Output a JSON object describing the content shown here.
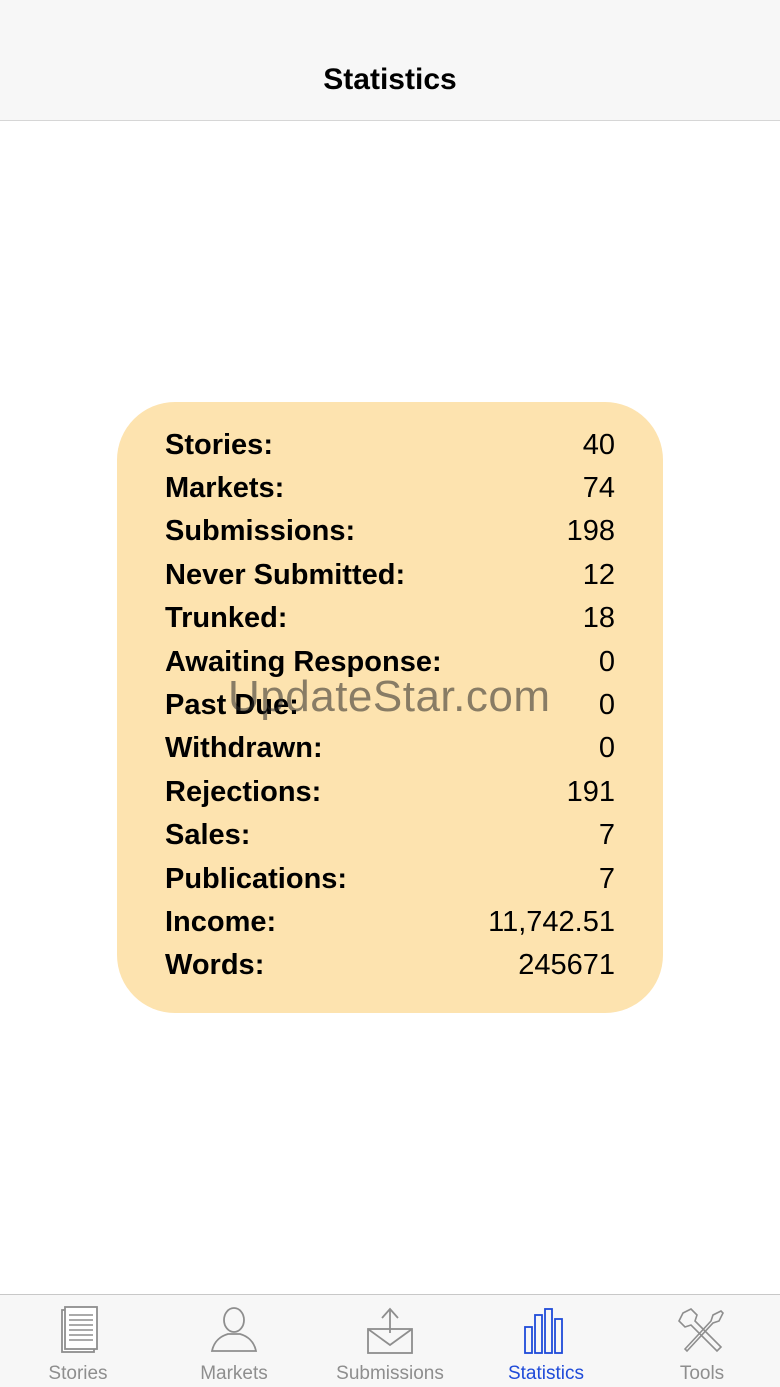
{
  "nav": {
    "title": "Statistics"
  },
  "stats": [
    {
      "label": "Stories:",
      "value": "40"
    },
    {
      "label": "Markets:",
      "value": "74"
    },
    {
      "label": "Submissions:",
      "value": "198"
    },
    {
      "label": "Never Submitted:",
      "value": "12"
    },
    {
      "label": "Trunked:",
      "value": "18"
    },
    {
      "label": "Awaiting Response:",
      "value": "0"
    },
    {
      "label": "Past Due:",
      "value": "0"
    },
    {
      "label": "Withdrawn:",
      "value": "0"
    },
    {
      "label": "Rejections:",
      "value": "191"
    },
    {
      "label": "Sales:",
      "value": "7"
    },
    {
      "label": "Publications:",
      "value": "7"
    },
    {
      "label": "Income:",
      "value": "11,742.51"
    },
    {
      "label": "Words:",
      "value": "245671"
    }
  ],
  "watermark": "UpdateStar.com",
  "tabs": [
    {
      "label": "Stories",
      "icon": "document-icon",
      "active": false
    },
    {
      "label": "Markets",
      "icon": "person-icon",
      "active": false
    },
    {
      "label": "Submissions",
      "icon": "envelope-upload-icon",
      "active": false
    },
    {
      "label": "Statistics",
      "icon": "bar-chart-icon",
      "active": true
    },
    {
      "label": "Tools",
      "icon": "tools-icon",
      "active": false
    }
  ],
  "colors": {
    "card_background": "#fde3af",
    "active_tab": "#1f4bd9",
    "inactive_tab": "#8e8e8e"
  }
}
